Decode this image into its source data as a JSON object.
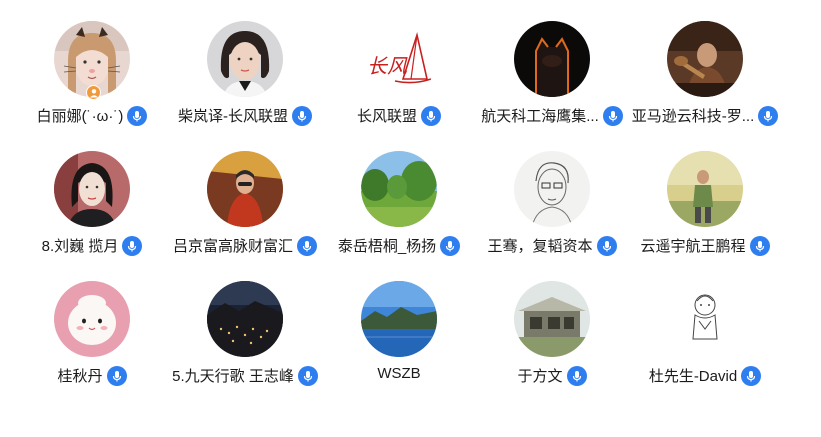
{
  "participants": [
    {
      "name": "白丽娜(˙·ω·˙)",
      "mic": "mic-icon",
      "host_badge": "host-badge-icon"
    },
    {
      "name": "柴岚译-长风联盟",
      "mic": "mic-icon"
    },
    {
      "name": "长风联盟",
      "mic": "mic-icon",
      "logo_text": "长风"
    },
    {
      "name": "航天科工海鹰集...",
      "mic": "mic-icon"
    },
    {
      "name": "亚马逊云科技-罗...",
      "mic": "mic-icon"
    },
    {
      "name": "8.刘巍 揽月",
      "mic": "mic-icon"
    },
    {
      "name": "吕京富高脉财富汇",
      "mic": "mic-icon"
    },
    {
      "name": "泰岳梧桐_杨扬",
      "mic": "mic-icon"
    },
    {
      "name": "王骞，复韬资本",
      "mic": "mic-icon"
    },
    {
      "name": "云遥宇航王鹏程",
      "mic": "mic-icon"
    },
    {
      "name": "桂秋丹",
      "mic": "mic-icon"
    },
    {
      "name": "5.九天行歌 王志峰",
      "mic": "mic-icon"
    },
    {
      "name": "WSZB"
    },
    {
      "name": "于方文",
      "mic": "mic-icon"
    },
    {
      "name": "杜先生-David",
      "mic": "mic-icon"
    }
  ],
  "colors": {
    "mic_bg": "#2f7ef0",
    "host_badge": "#f29a3a",
    "name_text": "#1b1b1b"
  }
}
